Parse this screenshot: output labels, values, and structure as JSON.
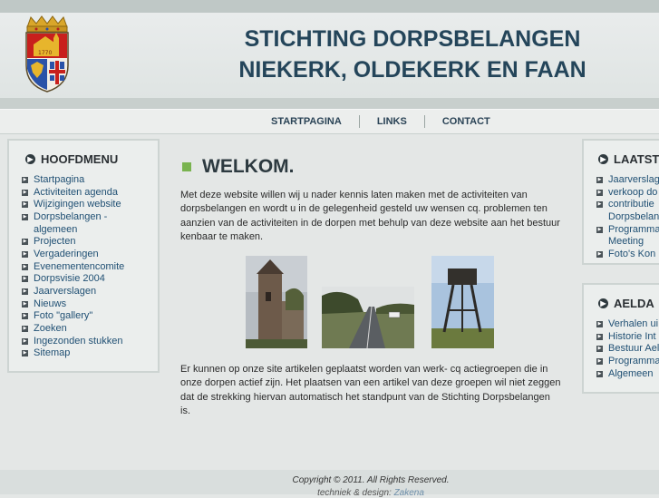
{
  "header": {
    "title_line1": "STICHTING DORPSBELANGEN",
    "title_line2": "NIEKERK, OLDEKERK EN FAAN",
    "logo_icon": "coat-of-arms-icon"
  },
  "nav": {
    "items": [
      {
        "label": "STARTPAGINA"
      },
      {
        "label": "LINKS"
      },
      {
        "label": "CONTACT"
      }
    ]
  },
  "left_menu": {
    "title": "HOOFDMENU",
    "items": [
      {
        "label": "Startpagina"
      },
      {
        "label": "Activiteiten agenda"
      },
      {
        "label": "Wijzigingen website"
      },
      {
        "label": "Dorpsbelangen -"
      },
      {
        "label": "algemeen"
      },
      {
        "label": "Projecten"
      },
      {
        "label": "Vergaderingen"
      },
      {
        "label": "Evenementencomite"
      },
      {
        "label": "Dorpsvisie 2004"
      },
      {
        "label": "Jaarverslagen"
      },
      {
        "label": "Nieuws"
      },
      {
        "label": "Foto \"gallery\""
      },
      {
        "label": "Zoeken"
      },
      {
        "label": "Ingezonden stukken"
      },
      {
        "label": "Sitemap"
      }
    ]
  },
  "main": {
    "heading": "WELKOM.",
    "intro": "Met deze website willen wij u nader kennis laten maken met de activiteiten van dorpsbelangen en wordt u in de gelegenheid gesteld uw wensen cq. problemen ten aanzien van de activiteiten in de dorpen met behulp van deze website aan het bestuur kenbaar te maken.",
    "body": "Er kunnen op onze site artikelen geplaatst worden van werk- cq actiegroepen die in onze dorpen actief zijn. Het plaatsen van een artikel van deze groepen wil niet zeggen dat de strekking hiervan automatisch het standpunt van de Stichting Dorpsbelangen is."
  },
  "right_box1": {
    "title": "LAATST",
    "items": [
      {
        "label": "Jaarverslag"
      },
      {
        "label": "verkoop do"
      },
      {
        "label": "contributie"
      },
      {
        "label": "Dorpsbelan"
      },
      {
        "label": "Programma"
      },
      {
        "label": "Meeting"
      },
      {
        "label": "Foto's Kon"
      }
    ]
  },
  "right_box2": {
    "title": "AELDA",
    "items": [
      {
        "label": "Verhalen ui"
      },
      {
        "label": "Historie Int"
      },
      {
        "label": "Bestuur Ael"
      },
      {
        "label": "Programma"
      },
      {
        "label": "Algemeen"
      }
    ]
  },
  "footer": {
    "copyright": "Copyright © 2011. All Rights Reserved.",
    "credit_prefix": "techniek & design:",
    "credit_link": "Zakena"
  },
  "colors": {
    "title": "#24455a",
    "link": "#1f4f73",
    "accent_square": "#79b34f"
  }
}
